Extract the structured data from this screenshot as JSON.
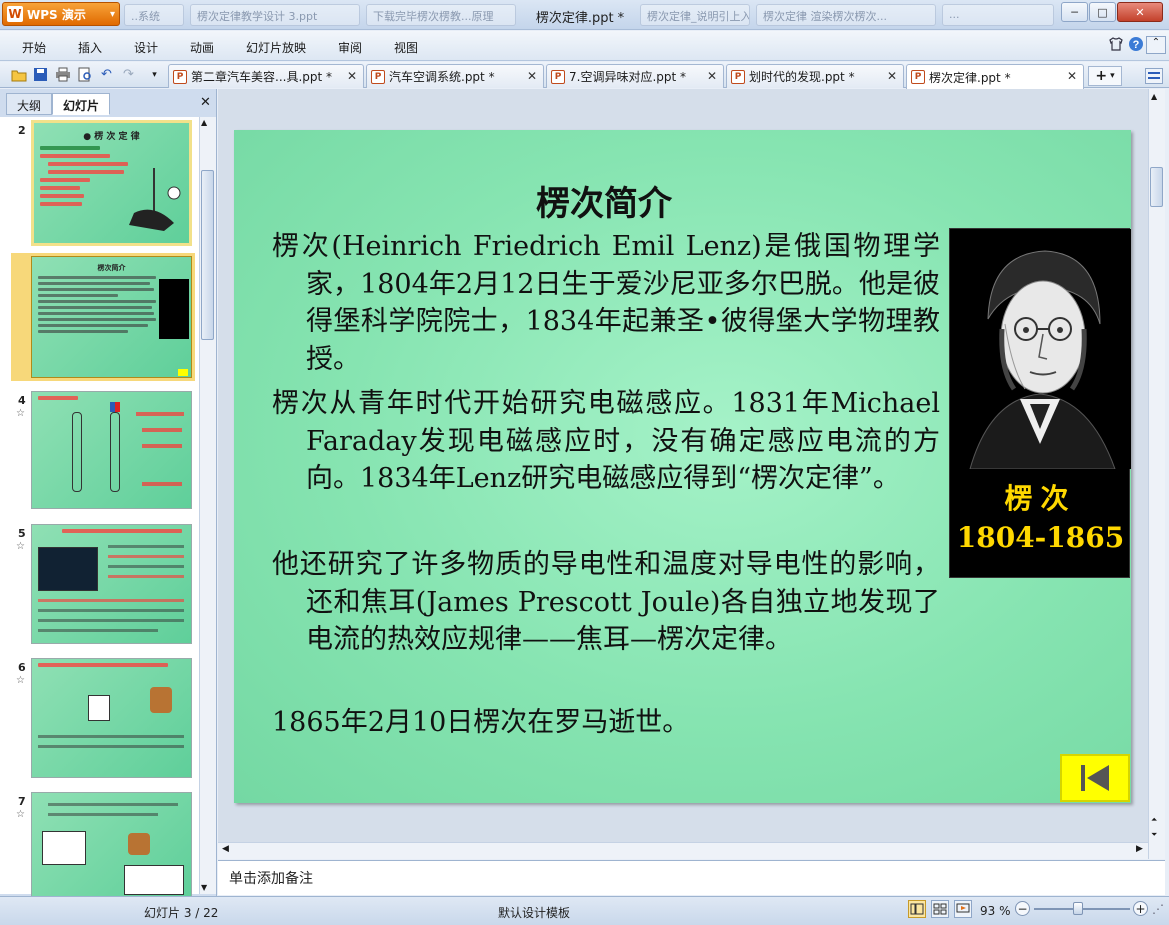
{
  "app": {
    "name": "WPS 演示",
    "logo_letter": "W",
    "caret": "▾"
  },
  "window": {
    "title": "楞次定律.ppt *",
    "min": "─",
    "max": "□",
    "close": "✕"
  },
  "background_tabs": [
    "..系统",
    "楞次定律教学设计 3.ppt",
    "下载完毕楞次楞教...原理",
    "楞次定律_说明引上入",
    "楞次定律 渲染楞次楞次...",
    "..."
  ],
  "menu": [
    "开始",
    "插入",
    "设计",
    "动画",
    "幻灯片放映",
    "审阅",
    "视图"
  ],
  "menu_right_icons": [
    "shirt-icon",
    "help-icon"
  ],
  "doc_tabs": [
    {
      "label": "第二章汽车美容...具.ppt *",
      "active": false
    },
    {
      "label": "汽车空调系统.ppt *",
      "active": false
    },
    {
      "label": "7.空调异味对应.ppt *",
      "active": false
    },
    {
      "label": "划时代的发现.ppt *",
      "active": false
    },
    {
      "label": "楞次定律.ppt *",
      "active": true
    }
  ],
  "new_tab": "+",
  "left_panel": {
    "tabs": [
      "大纲",
      "幻灯片"
    ],
    "active_tab": "幻灯片",
    "close": "✕",
    "slides": [
      {
        "num": "2",
        "star": false
      },
      {
        "num": "3",
        "star": true,
        "selected": true
      },
      {
        "num": "4",
        "star": true
      },
      {
        "num": "5",
        "star": true
      },
      {
        "num": "6",
        "star": true
      },
      {
        "num": "7",
        "star": true
      }
    ],
    "star_glyph": "☆"
  },
  "slide": {
    "title": "楞次简介",
    "paragraphs": [
      "楞次(Heinrich Friedrich Emil Lenz)是俄国物理学家，1804年2月12日生于爱沙尼亚多尔巴脱。他是彼得堡科学院院士，1834年起兼圣•彼得堡大学物理教授。",
      "楞次从青年时代开始研究电磁感应。1831年Michael  Faraday发现电磁感应时，没有确定感应电流的方向。1834年Lenz研究电磁感应得到“楞次定律”。",
      "他还研究了许多物质的导电性和温度对导电性的影响，还和焦耳(James Prescott  Joule)各自独立地发现了电流的热效应规律——焦耳—楞次定律。",
      "1865年2月10日楞次在罗马逝世。"
    ],
    "portrait": {
      "name": "楞次",
      "years": "1804-1865"
    },
    "colors": {
      "background": "#8fe6b6",
      "portrait_text": "#ffd800",
      "nav_button": "#ffff00"
    }
  },
  "notes": {
    "placeholder": "单击添加备注"
  },
  "status": {
    "slide_counter": "幻灯片 3 / 22",
    "template": "默认设计模板",
    "zoom": "93 %",
    "zoom_minus": "−",
    "zoom_plus": "+"
  }
}
